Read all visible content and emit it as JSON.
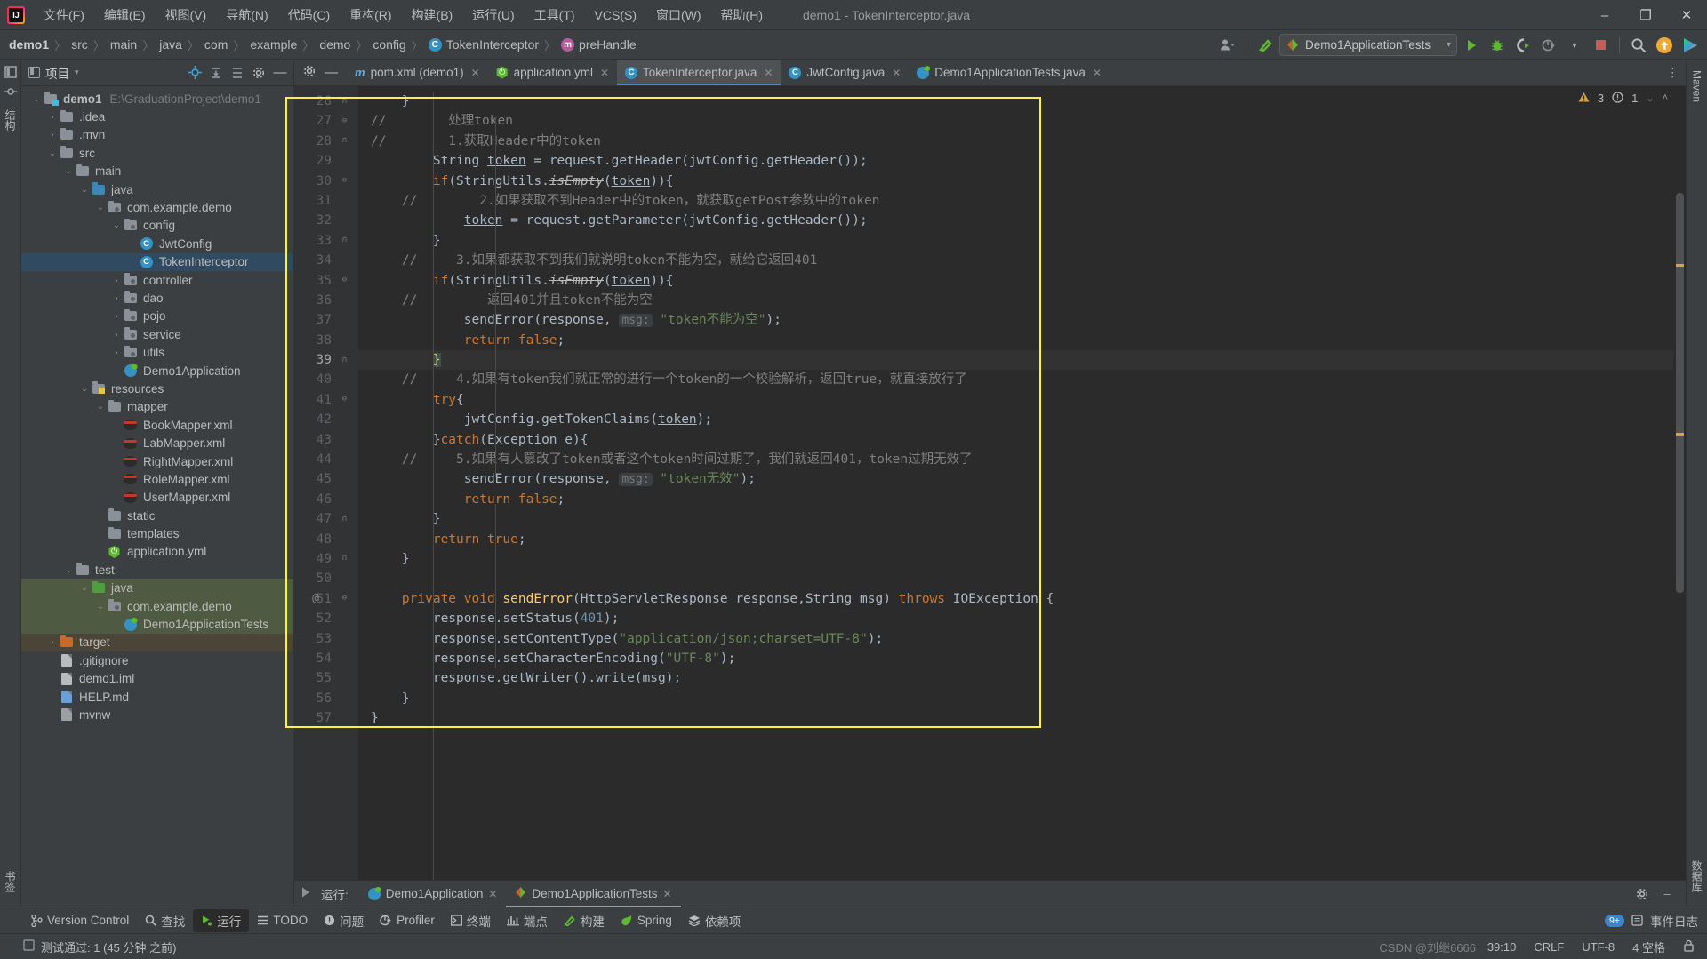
{
  "window": {
    "title": "demo1 - TokenInterceptor.java",
    "minimize": "–",
    "maximize": "❐",
    "close": "✕"
  },
  "menu": {
    "items": [
      "文件(F)",
      "编辑(E)",
      "视图(V)",
      "导航(N)",
      "代码(C)",
      "重构(R)",
      "构建(B)",
      "运行(U)",
      "工具(T)",
      "VCS(S)",
      "窗口(W)",
      "帮助(H)"
    ]
  },
  "breadcrumb": {
    "items": [
      "demo1",
      "src",
      "main",
      "java",
      "com",
      "example",
      "demo",
      "config",
      "TokenInterceptor",
      "preHandle"
    ],
    "class_badge": "C",
    "method_badge": "m",
    "separator": "〉"
  },
  "toolbar": {
    "run_config": "Demo1ApplicationTests",
    "run_config_caret": "▾",
    "icons": [
      "account-icon",
      "build-hammer-icon",
      "run-icon",
      "debug-icon",
      "run-coverage-icon",
      "profiler-icon",
      "stop-icon",
      "search-everywhere-icon",
      "updates-icon",
      "ide-assistant-icon"
    ]
  },
  "project_panel": {
    "title": "项目",
    "title_caret": "▾",
    "header_icons": [
      "locate-icon",
      "expand-all-icon",
      "collapse-all-icon",
      "settings-icon",
      "hide-icon"
    ],
    "tree": [
      {
        "depth": 0,
        "arrow": "⌄",
        "icon": "module-folder",
        "label": "demo1",
        "path": "E:\\GraduationProject\\demo1",
        "bold": true,
        "state": "none"
      },
      {
        "depth": 1,
        "arrow": "›",
        "icon": "folder",
        "label": ".idea",
        "state": "none"
      },
      {
        "depth": 1,
        "arrow": "›",
        "icon": "folder",
        "label": ".mvn",
        "state": "none"
      },
      {
        "depth": 1,
        "arrow": "⌄",
        "icon": "folder",
        "label": "src",
        "state": "none"
      },
      {
        "depth": 2,
        "arrow": "⌄",
        "icon": "folder",
        "label": "main",
        "state": "none"
      },
      {
        "depth": 3,
        "arrow": "⌄",
        "icon": "folder-blue",
        "label": "java",
        "state": "none"
      },
      {
        "depth": 4,
        "arrow": "⌄",
        "icon": "package",
        "label": "com.example.demo",
        "state": "none"
      },
      {
        "depth": 5,
        "arrow": "⌄",
        "icon": "package",
        "label": "config",
        "state": "none"
      },
      {
        "depth": 6,
        "arrow": "",
        "icon": "class",
        "label": "JwtConfig",
        "state": "none"
      },
      {
        "depth": 6,
        "arrow": "",
        "icon": "class",
        "label": "TokenInterceptor",
        "state": "selected"
      },
      {
        "depth": 5,
        "arrow": "›",
        "icon": "package",
        "label": "controller",
        "state": "none"
      },
      {
        "depth": 5,
        "arrow": "›",
        "icon": "package",
        "label": "dao",
        "state": "none"
      },
      {
        "depth": 5,
        "arrow": "›",
        "icon": "package",
        "label": "pojo",
        "state": "none"
      },
      {
        "depth": 5,
        "arrow": "›",
        "icon": "package",
        "label": "service",
        "state": "none"
      },
      {
        "depth": 5,
        "arrow": "›",
        "icon": "package",
        "label": "utils",
        "state": "none"
      },
      {
        "depth": 5,
        "arrow": "",
        "icon": "springboot",
        "label": "Demo1Application",
        "state": "none"
      },
      {
        "depth": 3,
        "arrow": "⌄",
        "icon": "folder-resources",
        "label": "resources",
        "state": "none"
      },
      {
        "depth": 4,
        "arrow": "⌄",
        "icon": "folder",
        "label": "mapper",
        "state": "none"
      },
      {
        "depth": 5,
        "arrow": "",
        "icon": "mybatis",
        "label": "BookMapper.xml",
        "state": "none"
      },
      {
        "depth": 5,
        "arrow": "",
        "icon": "mybatis",
        "label": "LabMapper.xml",
        "state": "none"
      },
      {
        "depth": 5,
        "arrow": "",
        "icon": "mybatis",
        "label": "RightMapper.xml",
        "state": "none"
      },
      {
        "depth": 5,
        "arrow": "",
        "icon": "mybatis",
        "label": "RoleMapper.xml",
        "state": "none"
      },
      {
        "depth": 5,
        "arrow": "",
        "icon": "mybatis",
        "label": "UserMapper.xml",
        "state": "none"
      },
      {
        "depth": 4,
        "arrow": "",
        "icon": "folder",
        "label": "static",
        "state": "none"
      },
      {
        "depth": 4,
        "arrow": "",
        "icon": "folder",
        "label": "templates",
        "state": "none"
      },
      {
        "depth": 4,
        "arrow": "",
        "icon": "spring-yml",
        "label": "application.yml",
        "state": "none"
      },
      {
        "depth": 2,
        "arrow": "⌄",
        "icon": "folder",
        "label": "test",
        "state": "none"
      },
      {
        "depth": 3,
        "arrow": "⌄",
        "icon": "folder-green",
        "label": "java",
        "state": "green"
      },
      {
        "depth": 4,
        "arrow": "⌄",
        "icon": "package",
        "label": "com.example.demo",
        "state": "green"
      },
      {
        "depth": 5,
        "arrow": "",
        "icon": "springboot",
        "label": "Demo1ApplicationTests",
        "state": "green"
      },
      {
        "depth": 1,
        "arrow": "›",
        "icon": "folder-orange",
        "label": "target",
        "state": "brown"
      },
      {
        "depth": 1,
        "arrow": "",
        "icon": "file",
        "label": ".gitignore",
        "state": "none"
      },
      {
        "depth": 1,
        "arrow": "",
        "icon": "file-iml",
        "label": "demo1.iml",
        "state": "none"
      },
      {
        "depth": 1,
        "arrow": "",
        "icon": "file-md",
        "label": "HELP.md",
        "state": "none"
      },
      {
        "depth": 1,
        "arrow": "",
        "icon": "file-exec",
        "label": "mvnw",
        "state": "none"
      }
    ]
  },
  "editor": {
    "tabs": [
      {
        "label": "pom.xml (demo1)",
        "icon": "maven-icon",
        "active": false,
        "close": "✕"
      },
      {
        "label": "application.yml",
        "icon": "spring-icon",
        "active": false,
        "close": "✕"
      },
      {
        "label": "TokenInterceptor.java",
        "icon": "class-icon",
        "active": true,
        "close": "✕"
      },
      {
        "label": "JwtConfig.java",
        "icon": "class-icon",
        "active": false,
        "close": "✕"
      },
      {
        "label": "Demo1ApplicationTests.java",
        "icon": "springboot-icon",
        "active": false,
        "close": "✕"
      }
    ],
    "tabs_overflow": "⋮",
    "inspection": {
      "warnings": "3",
      "weak_warnings": "1",
      "warn_glyph": "⚠",
      "weak_glyph": "ⓘ",
      "chevron_down": "⌄",
      "chevron_up": "˄"
    },
    "first_line": 26,
    "current_line": 39,
    "lines": [
      {
        "n": 26,
        "fold": "∩",
        "tokens": [
          {
            "t": "    }",
            "c": "id"
          }
        ]
      },
      {
        "n": 27,
        "fold": "⊖",
        "tokens": [
          {
            "t": "//",
            "c": "cmt"
          },
          {
            "t": "        处理token",
            "c": "cmt"
          }
        ]
      },
      {
        "n": 28,
        "fold": "∩",
        "tokens": [
          {
            "t": "//",
            "c": "cmt"
          },
          {
            "t": "        1.获取Header中的token",
            "c": "cmt"
          }
        ]
      },
      {
        "n": 29,
        "fold": "",
        "tokens": [
          {
            "t": "        ",
            "c": "id"
          },
          {
            "t": "String",
            "c": "id"
          },
          {
            "t": " ",
            "c": "id"
          },
          {
            "t": "token",
            "c": "stat"
          },
          {
            "t": " = request.getHeader(jwtConfig.getHeader());",
            "c": "id"
          }
        ]
      },
      {
        "n": 30,
        "fold": "⊖",
        "tokens": [
          {
            "t": "        ",
            "c": "id"
          },
          {
            "t": "if",
            "c": "kw"
          },
          {
            "t": "(StringUtils.",
            "c": "id"
          },
          {
            "t": "isEmpty",
            "c": "strike"
          },
          {
            "t": "(",
            "c": "id"
          },
          {
            "t": "token",
            "c": "stat"
          },
          {
            "t": ")){",
            "c": "id"
          }
        ]
      },
      {
        "n": 31,
        "fold": "",
        "tokens": [
          {
            "t": "    //",
            "c": "cmt"
          },
          {
            "t": "        2.如果获取不到Header中的token，就获取getPost参数中的token",
            "c": "cmt"
          }
        ]
      },
      {
        "n": 32,
        "fold": "",
        "tokens": [
          {
            "t": "            ",
            "c": "id"
          },
          {
            "t": "token",
            "c": "stat"
          },
          {
            "t": " = request.getParameter(jwtConfig.getHeader());",
            "c": "id"
          }
        ]
      },
      {
        "n": 33,
        "fold": "∩",
        "tokens": [
          {
            "t": "        }",
            "c": "id"
          }
        ]
      },
      {
        "n": 34,
        "fold": "",
        "tokens": [
          {
            "t": "    //",
            "c": "cmt"
          },
          {
            "t": "     3.如果都获取不到我们就说明token不能为空，就给它返回401",
            "c": "cmt"
          }
        ]
      },
      {
        "n": 35,
        "fold": "⊖",
        "tokens": [
          {
            "t": "        ",
            "c": "id"
          },
          {
            "t": "if",
            "c": "kw"
          },
          {
            "t": "(StringUtils.",
            "c": "id"
          },
          {
            "t": "isEmpty",
            "c": "strike"
          },
          {
            "t": "(",
            "c": "id"
          },
          {
            "t": "token",
            "c": "stat"
          },
          {
            "t": ")){",
            "c": "brace"
          }
        ]
      },
      {
        "n": 36,
        "fold": "",
        "tokens": [
          {
            "t": "    //",
            "c": "cmt"
          },
          {
            "t": "         返回401并且token不能为空",
            "c": "cmt"
          }
        ]
      },
      {
        "n": 37,
        "fold": "",
        "tokens": [
          {
            "t": "            sendError(response, ",
            "c": "id"
          },
          {
            "t": "msg:",
            "c": "hint"
          },
          {
            "t": " ",
            "c": "id"
          },
          {
            "t": "\"token不能为空\"",
            "c": "str"
          },
          {
            "t": ");",
            "c": "id"
          }
        ]
      },
      {
        "n": 38,
        "fold": "",
        "tokens": [
          {
            "t": "            ",
            "c": "id"
          },
          {
            "t": "return false",
            "c": "kw"
          },
          {
            "t": ";",
            "c": "id"
          }
        ]
      },
      {
        "n": 39,
        "fold": "∩",
        "tokens": [
          {
            "t": "        }",
            "c": "braceY"
          }
        ],
        "current": true
      },
      {
        "n": 40,
        "fold": "",
        "tokens": [
          {
            "t": "    //",
            "c": "cmt"
          },
          {
            "t": "     4.如果有token我们就正常的进行一个token的一个校验解析，返回true，就直接放行了",
            "c": "cmt"
          }
        ]
      },
      {
        "n": 41,
        "fold": "⊖",
        "tokens": [
          {
            "t": "        ",
            "c": "id"
          },
          {
            "t": "try",
            "c": "kw"
          },
          {
            "t": "{",
            "c": "id"
          }
        ]
      },
      {
        "n": 42,
        "fold": "",
        "tokens": [
          {
            "t": "            jwtConfig.getTokenClaims(",
            "c": "id"
          },
          {
            "t": "token",
            "c": "stat"
          },
          {
            "t": ");",
            "c": "id"
          }
        ]
      },
      {
        "n": 43,
        "fold": "",
        "tokens": [
          {
            "t": "        }",
            "c": "id"
          },
          {
            "t": "catch",
            "c": "kw"
          },
          {
            "t": "(Exception e){",
            "c": "id"
          }
        ]
      },
      {
        "n": 44,
        "fold": "",
        "tokens": [
          {
            "t": "    //",
            "c": "cmt"
          },
          {
            "t": "     5.如果有人篡改了token或者这个token时间过期了，我们就返回401，token过期无效了",
            "c": "cmt"
          }
        ]
      },
      {
        "n": 45,
        "fold": "",
        "tokens": [
          {
            "t": "            sendError(response, ",
            "c": "id"
          },
          {
            "t": "msg:",
            "c": "hint"
          },
          {
            "t": " ",
            "c": "id"
          },
          {
            "t": "\"token无效\"",
            "c": "str"
          },
          {
            "t": ");",
            "c": "id"
          }
        ]
      },
      {
        "n": 46,
        "fold": "",
        "tokens": [
          {
            "t": "            ",
            "c": "id"
          },
          {
            "t": "return false",
            "c": "kw"
          },
          {
            "t": ";",
            "c": "id"
          }
        ]
      },
      {
        "n": 47,
        "fold": "∩",
        "tokens": [
          {
            "t": "        }",
            "c": "id"
          }
        ]
      },
      {
        "n": 48,
        "fold": "",
        "tokens": [
          {
            "t": "        ",
            "c": "id"
          },
          {
            "t": "return true",
            "c": "kw"
          },
          {
            "t": ";",
            "c": "id"
          }
        ]
      },
      {
        "n": 49,
        "fold": "∩",
        "tokens": [
          {
            "t": "    }",
            "c": "id"
          }
        ]
      },
      {
        "n": 50,
        "fold": "",
        "tokens": [
          {
            "t": "",
            "c": "id"
          }
        ]
      },
      {
        "n": 51,
        "fold": "⊖",
        "at": "@",
        "tokens": [
          {
            "t": "    ",
            "c": "id"
          },
          {
            "t": "private void ",
            "c": "kw"
          },
          {
            "t": "sendError",
            "c": "mth"
          },
          {
            "t": "(HttpServletResponse response,String msg) ",
            "c": "id"
          },
          {
            "t": "throws",
            "c": "kw"
          },
          {
            "t": " IOException {",
            "c": "id"
          }
        ]
      },
      {
        "n": 52,
        "fold": "",
        "tokens": [
          {
            "t": "        response.setStatus(",
            "c": "id"
          },
          {
            "t": "401",
            "c": "num"
          },
          {
            "t": ");",
            "c": "id"
          }
        ]
      },
      {
        "n": 53,
        "fold": "",
        "tokens": [
          {
            "t": "        response.setContentType(",
            "c": "id"
          },
          {
            "t": "\"application/json;charset=UTF-8\"",
            "c": "str"
          },
          {
            "t": ");",
            "c": "id"
          }
        ]
      },
      {
        "n": 54,
        "fold": "",
        "tokens": [
          {
            "t": "        response.setCharacterEncoding(",
            "c": "id"
          },
          {
            "t": "\"UTF-8\"",
            "c": "str"
          },
          {
            "t": ");",
            "c": "id"
          }
        ]
      },
      {
        "n": 55,
        "fold": "",
        "tokens": [
          {
            "t": "        response.getWriter().write(msg);",
            "c": "id"
          }
        ]
      },
      {
        "n": 56,
        "fold": "",
        "tokens": [
          {
            "t": "    }",
            "c": "id"
          }
        ]
      },
      {
        "n": 57,
        "fold": "",
        "tokens": [
          {
            "t": "}",
            "c": "id"
          }
        ]
      }
    ]
  },
  "run_window": {
    "label": "运行:",
    "tabs": [
      {
        "label": "Demo1Application",
        "icon": "springboot-icon",
        "active": false,
        "close": "✕"
      },
      {
        "label": "Demo1ApplicationTests",
        "icon": "test-icon",
        "active": true,
        "close": "✕"
      }
    ],
    "settings_icon": "⚙",
    "minimize_icon": "–"
  },
  "bottom_bar": {
    "items": [
      {
        "label": "Version Control",
        "icon": "branch-icon",
        "selected": false
      },
      {
        "label": "查找",
        "icon": "search-icon",
        "selected": false
      },
      {
        "label": "运行",
        "icon": "run-icon",
        "selected": true
      },
      {
        "label": "TODO",
        "icon": "todo-icon",
        "selected": false
      },
      {
        "label": "问题",
        "icon": "problems-icon",
        "selected": false
      },
      {
        "label": "Profiler",
        "icon": "profiler-icon",
        "selected": false
      },
      {
        "label": "终端",
        "icon": "terminal-icon",
        "selected": false
      },
      {
        "label": "端点",
        "icon": "endpoints-icon",
        "selected": false
      },
      {
        "label": "构建",
        "icon": "build-icon",
        "selected": false
      },
      {
        "label": "Spring",
        "icon": "spring-icon",
        "selected": false
      },
      {
        "label": "依赖项",
        "icon": "dependencies-icon",
        "selected": false
      }
    ],
    "event_log": {
      "label": "事件日志",
      "count": "9+",
      "icon": "event-log-icon"
    }
  },
  "status_bar": {
    "message": "测试通过: 1 (45 分钟 之前)",
    "message_icon": "test-passed-icon",
    "caret_position": "39:10",
    "line_separator": "CRLF",
    "encoding": "UTF-8",
    "indent": "4 空格",
    "lock_icon": "ὑ2",
    "watermark": "CSDN @刘继6666"
  },
  "left_strip": {
    "items": [
      "项目",
      "结构",
      "书签"
    ],
    "selected": "项目"
  },
  "right_strip": {
    "items": [
      "Maven",
      "数据库"
    ]
  },
  "colors": {
    "accent_blue": "#3592c4",
    "selection": "#2f4a61",
    "highlight_yellow": "#ffef3f",
    "test_green": "#4e5a42",
    "target_brown": "#4b4537",
    "editor_bg": "#2b2b2b",
    "panel_bg": "#3c3f41",
    "gutter_bg": "#313335"
  }
}
